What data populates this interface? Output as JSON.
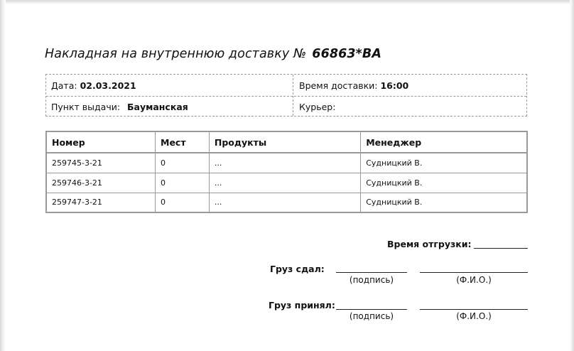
{
  "document": {
    "title": "Накладная на внутреннюю доставку №",
    "number": "66863*BA"
  },
  "info": {
    "date_label": "Дата:",
    "date_value": "02.03.2021",
    "delivery_time_label": "Время доставки:",
    "delivery_time_value": "16:00",
    "pickup_label": "Пункт выдачи:",
    "pickup_value": "Бауманская",
    "courier_label": "Курьер:",
    "courier_value": ""
  },
  "table": {
    "headers": [
      "Номер",
      "Мест",
      "Продукты",
      "Менеджер"
    ],
    "rows": [
      [
        "259745-3-21",
        "0",
        "...",
        "Судницкий В."
      ],
      [
        "259746-3-21",
        "0",
        "...",
        "Судницкий В."
      ],
      [
        "259747-3-21",
        "0",
        "...",
        "Судницкий В."
      ]
    ]
  },
  "signatures": {
    "shipment_time_label": "Время отгрузки:",
    "handed_over_label": "Груз сдал:",
    "received_label": "Груз принял:",
    "signature_caption": "(подпись)",
    "name_caption": "(Ф.И.О.)"
  }
}
